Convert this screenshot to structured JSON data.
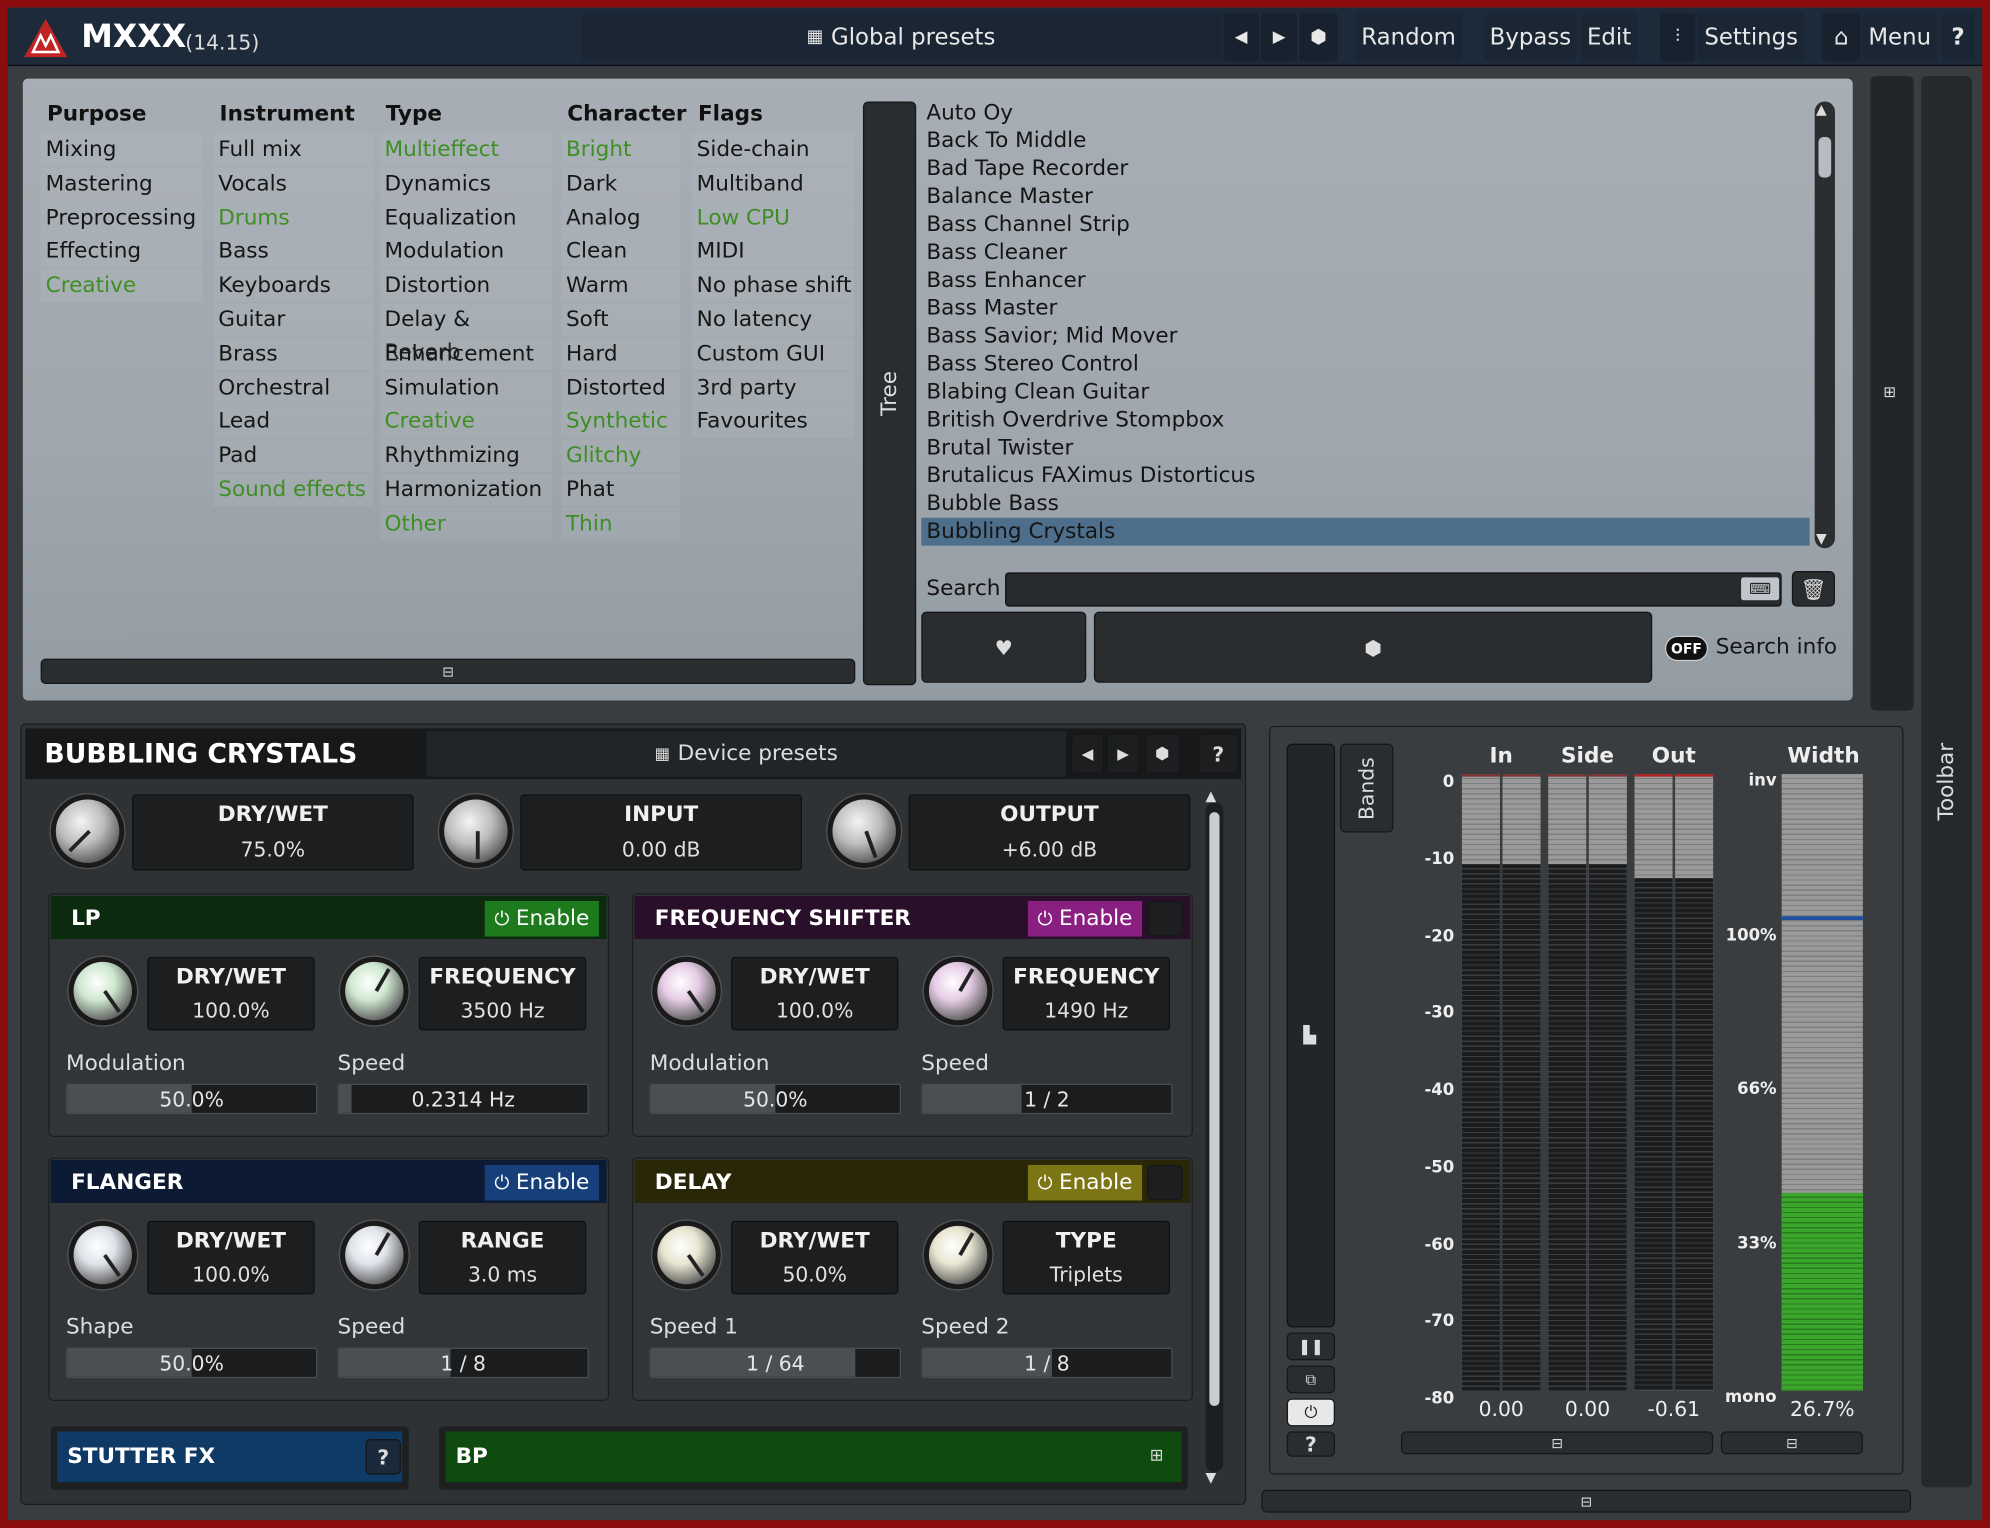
{
  "app": {
    "name": "MXXX",
    "version": "(14.15)"
  },
  "topbar": {
    "global_presets": "Global presets",
    "random": "Random",
    "bypass": "Bypass",
    "edit": "Edit",
    "settings": "Settings",
    "menu": "Menu",
    "help": "?"
  },
  "browser": {
    "columns": [
      {
        "header": "Purpose",
        "items": [
          "Mixing",
          "Mastering",
          "Preprocessing",
          "Effecting",
          "Creative"
        ],
        "highlighted": [
          "Creative"
        ]
      },
      {
        "header": "Instrument",
        "items": [
          "Full mix",
          "Vocals",
          "Drums",
          "Bass",
          "Keyboards",
          "Guitar",
          "Brass",
          "Orchestral",
          "Lead",
          "Pad",
          "Sound effects"
        ],
        "highlighted": [
          "Drums",
          "Sound effects"
        ]
      },
      {
        "header": "Type",
        "items": [
          "Multieffect",
          "Dynamics",
          "Equalization",
          "Modulation",
          "Distortion",
          "Delay & Reverb",
          "Enhancement",
          "Simulation",
          "Creative",
          "Rhythmizing",
          "Harmonization",
          "Other"
        ],
        "highlighted": [
          "Multieffect",
          "Creative",
          "Other"
        ]
      },
      {
        "header": "Character",
        "items": [
          "Bright",
          "Dark",
          "Analog",
          "Clean",
          "Warm",
          "Soft",
          "Hard",
          "Distorted",
          "Synthetic",
          "Glitchy",
          "Phat",
          "Thin"
        ],
        "highlighted": [
          "Bright",
          "Synthetic",
          "Glitchy",
          "Thin"
        ]
      },
      {
        "header": "Flags",
        "items": [
          "Side-chain",
          "Multiband",
          "Low CPU",
          "MIDI",
          "No phase shift",
          "No latency",
          "Custom GUI",
          "3rd party",
          "Favourites"
        ],
        "highlighted": [
          "Low CPU"
        ]
      }
    ],
    "tree_label": "Tree",
    "presets": [
      "Auto Oy",
      "Back To Middle",
      "Bad Tape Recorder",
      "Balance Master",
      "Bass Channel Strip",
      "Bass Cleaner",
      "Bass Enhancer",
      "Bass Master",
      "Bass Savior; Mid Mover",
      "Bass Stereo Control",
      "Blabing Clean Guitar",
      "British Overdrive Stompbox",
      "Brutal Twister",
      "Brutalicus FAXimus Distorticus",
      "Bubble Bass",
      "Bubbling Crystals"
    ],
    "selected_preset": "Bubbling Crystals",
    "search_label": "Search",
    "search_value": "",
    "search_info_toggle": "OFF",
    "search_info_label": "Search info"
  },
  "side": {
    "toolbar_label": "Toolbar"
  },
  "device": {
    "title": "BUBBLING CRYSTALS",
    "device_presets": "Device presets",
    "help": "?",
    "main_params": [
      {
        "label": "DRY/WET",
        "value": "75.0%"
      },
      {
        "label": "INPUT",
        "value": "0.00 dB"
      },
      {
        "label": "OUTPUT",
        "value": "+6.00 dB"
      }
    ],
    "modules": {
      "lp": {
        "name": "LP",
        "enable": "Enable",
        "color": "#1d7a1d",
        "p1": {
          "label": "DRY/WET",
          "value": "100.0%"
        },
        "p2": {
          "label": "FREQUENCY",
          "value": "3500 Hz"
        },
        "s1": {
          "label": "Modulation",
          "value": "50.0%",
          "level": 0.5
        },
        "s2": {
          "label": "Speed",
          "value": "0.2314 Hz",
          "level": 0.05
        }
      },
      "fs": {
        "name": "FREQUENCY SHIFTER",
        "enable": "Enable",
        "color": "#8a1f82",
        "p1": {
          "label": "DRY/WET",
          "value": "100.0%"
        },
        "p2": {
          "label": "FREQUENCY",
          "value": "1490 Hz"
        },
        "s1": {
          "label": "Modulation",
          "value": "50.0%",
          "level": 0.5
        },
        "s2": {
          "label": "Speed",
          "value": "1 / 2",
          "level": 0.4
        }
      },
      "fl": {
        "name": "FLANGER",
        "enable": "Enable",
        "color": "#17407a",
        "p1": {
          "label": "DRY/WET",
          "value": "100.0%"
        },
        "p2": {
          "label": "RANGE",
          "value": "3.0 ms"
        },
        "s1": {
          "label": "Shape",
          "value": "50.0%",
          "level": 0.5
        },
        "s2": {
          "label": "Speed",
          "value": "1 / 8",
          "level": 0.45
        }
      },
      "dl": {
        "name": "DELAY",
        "enable": "Enable",
        "color": "#7c7516",
        "p1": {
          "label": "DRY/WET",
          "value": "50.0%"
        },
        "p2": {
          "label": "TYPE",
          "value": "Triplets"
        },
        "s1": {
          "label": "Speed 1",
          "value": "1 / 64",
          "level": 0.82
        },
        "s2": {
          "label": "Speed 2",
          "value": "1 / 8",
          "level": 0.52
        }
      }
    },
    "bottom_modules": {
      "stutter": "STUTTER FX",
      "stutter_help": "?",
      "bp": "BP"
    }
  },
  "meters": {
    "bands_label": "Bands",
    "help": "?",
    "headers": [
      "In",
      "Side",
      "Out",
      "Width"
    ],
    "db_scale": [
      "0",
      "-10",
      "-20",
      "-30",
      "-40",
      "-50",
      "-60",
      "-70",
      "-80"
    ],
    "width_scale": [
      "inv",
      "100%",
      "66%",
      "33%",
      "mono"
    ],
    "values": {
      "in": "0.00",
      "side": "0.00",
      "out": "-0.61",
      "width": "26.7%"
    },
    "levels_db": {
      "in": -11.7,
      "side": -11.7,
      "out": -13.5
    },
    "width_fraction": 0.267,
    "width_marker_fraction": 0.77
  }
}
